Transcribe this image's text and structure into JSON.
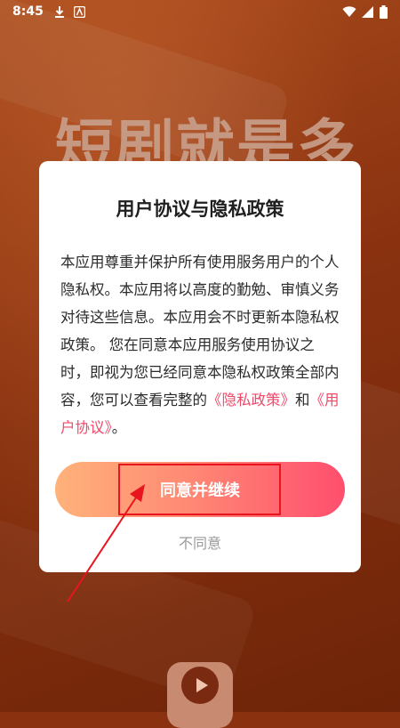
{
  "status_bar": {
    "time": "8:45",
    "left_icons": [
      "download-icon",
      "app-notification-icon"
    ],
    "right_icons": [
      "wifi-icon",
      "signal-icon",
      "battery-icon"
    ]
  },
  "background": {
    "slogan": "短剧就是多"
  },
  "dialog": {
    "title": "用户协议与隐私政策",
    "body_text": "本应用尊重并保护所有使用服务用户的个人隐私权。本应用将以高度的勤勉、审慎义务对待这些信息。本应用会不时更新本隐私权政策。 您在同意本应用服务使用协议之时，即视为您已经同意本隐私权政策全部内容，您可以查看完整的",
    "privacy_link": "《隐私政策》",
    "and_text": "和",
    "user_agreement_link": "《用户协议》",
    "end_text": "。",
    "agree_button": "同意并继续",
    "disagree_button": "不同意"
  },
  "colors": {
    "link": "#f04a6a",
    "button_gradient_start": "#ffb27a",
    "button_gradient_end": "#ff4e6e",
    "annotation": "#e8141e"
  }
}
